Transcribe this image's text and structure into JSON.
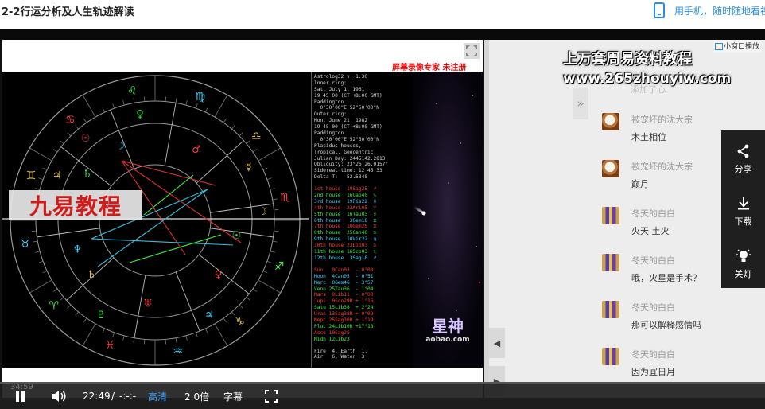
{
  "page": {
    "title": "2-2行运分析及人生轨迹解读",
    "phone_link": "用手机，随时随地看视"
  },
  "video": {
    "watermark": "屏幕录像专家  未注册",
    "brand_badge": "九易教程",
    "info_lines": [
      {
        "t": "Astrolog32 v. 1.30",
        "c": ""
      },
      {
        "t": "Inner ring:",
        "c": ""
      },
      {
        "t": "Sat, July 1, 1961",
        "c": ""
      },
      {
        "t": "19 45 00 (CT +8:00 GMT)",
        "c": ""
      },
      {
        "t": "Paddington",
        "c": ""
      },
      {
        "t": "  0°30'00\"E 52°50'00\"N",
        "c": ""
      },
      {
        "t": "Outer ring:",
        "c": ""
      },
      {
        "t": "Mon, June 21, 1982",
        "c": ""
      },
      {
        "t": "19 45 00 (CT +8:00 GMT)",
        "c": ""
      },
      {
        "t": "Paddington",
        "c": ""
      },
      {
        "t": "  0°30'00\"E 52°50'00\"N",
        "c": ""
      },
      {
        "t": "Placidus houses,",
        "c": ""
      },
      {
        "t": "Tropical, Geocentric.",
        "c": ""
      },
      {
        "t": "Julian Day: 2445142.2813",
        "c": ""
      },
      {
        "t": "Obliquity: 23°26'26.0157\"",
        "c": ""
      },
      {
        "t": "Sidereal time: 12 45 33",
        "c": ""
      },
      {
        "t": "Delta T:   52.5348",
        "c": ""
      },
      {
        "t": "",
        "c": "gap"
      },
      {
        "t": "1st house  10Sag25  ♐",
        "c": "red"
      },
      {
        "t": "2nd house  16Cap40  ♑",
        "c": "grn"
      },
      {
        "t": "3rd house  19Pis22  ♓",
        "c": "cyn"
      },
      {
        "t": "4th house  23Ari05  ♈",
        "c": "red"
      },
      {
        "t": "5th house  16Tau03  ♉",
        "c": "grn"
      },
      {
        "t": "6th house   3Gem18  ♊",
        "c": "cyn"
      },
      {
        "t": "7th house  10Gem25  ♊",
        "c": "red"
      },
      {
        "t": "8th house  25Can40  ♋",
        "c": "grn"
      },
      {
        "t": "9th house  10Vir22  ♍",
        "c": "cyn"
      },
      {
        "t": "10th house 23Lib03  ♎",
        "c": "red"
      },
      {
        "t": "11th house 16Sco03  ♏",
        "c": "grn"
      },
      {
        "t": "12th house  3Sag18  ♐",
        "c": "cyn"
      },
      {
        "t": "",
        "c": "gap"
      },
      {
        "t": "Sun   0Can03  - 0°00'",
        "c": "red"
      },
      {
        "t": "Moon  4Can05  - 0°51'",
        "c": "cyn"
      },
      {
        "t": "Merc  0Gem46  - 3°57'",
        "c": "cyn"
      },
      {
        "t": "Venu 25Tau36  - 1°04'",
        "c": "grn"
      },
      {
        "t": "Mars  9Lib11  - 0°00'",
        "c": "red"
      },
      {
        "t": "Jupi  0Sco29R + 1°16'",
        "c": "red"
      },
      {
        "t": "Satu 15Lib38  + 2°24'",
        "c": "grn"
      },
      {
        "t": "Uran 13Sag38R + 0°09'",
        "c": "red"
      },
      {
        "t": "Nept 25Sag30R + 1°19'",
        "c": "red"
      },
      {
        "t": "Plut 24Lib10R +17°18'",
        "c": "grn"
      },
      {
        "t": "Asce 10Sag25",
        "c": "red"
      },
      {
        "t": "Midh 12Lib23",
        "c": "grn"
      },
      {
        "t": "",
        "c": "gap"
      },
      {
        "t": "Fire  4, Earth  1,",
        "c": ""
      },
      {
        "t": "Air   6, Water  3",
        "c": ""
      }
    ],
    "nebula_logo": "星神",
    "nebula_url": "aobao.com"
  },
  "overlay": {
    "title": "上万套周易资料教程",
    "url": "www.265zhouyiw.com",
    "mini_window": "小窗口播放"
  },
  "chat": {
    "first_line": "添加了心",
    "messages": [
      {
        "user": "被宠坏的沈大宗",
        "text": "木土相位",
        "avatar": "dog"
      },
      {
        "user": "被宠坏的沈大宗",
        "text": "巅月",
        "avatar": "dog"
      },
      {
        "user": "冬天的白白",
        "text": "火天 土火",
        "avatar": "flag"
      },
      {
        "user": "冬天的白白",
        "text": "哦，火星是手术？",
        "avatar": "flag"
      },
      {
        "user": "冬天的白白",
        "text": "那可以解释感情吗",
        "avatar": "flag"
      },
      {
        "user": "冬天的白白",
        "text": "因为冝日月",
        "avatar": "flag"
      }
    ]
  },
  "actions": {
    "share": "分享",
    "download": "下载",
    "lights_off": "关灯"
  },
  "controls": {
    "current_time": "22:49",
    "separator": "/",
    "duration": "-:-:-",
    "quality": "高清",
    "speed": "2.0倍",
    "subtitles": "字幕",
    "ghost_time": "34:59",
    "progress_fraction": 0.0
  },
  "colors": {
    "accent": "#2a8de0",
    "hd": "#3aa3ff",
    "badge_red": "#d11a1a"
  }
}
